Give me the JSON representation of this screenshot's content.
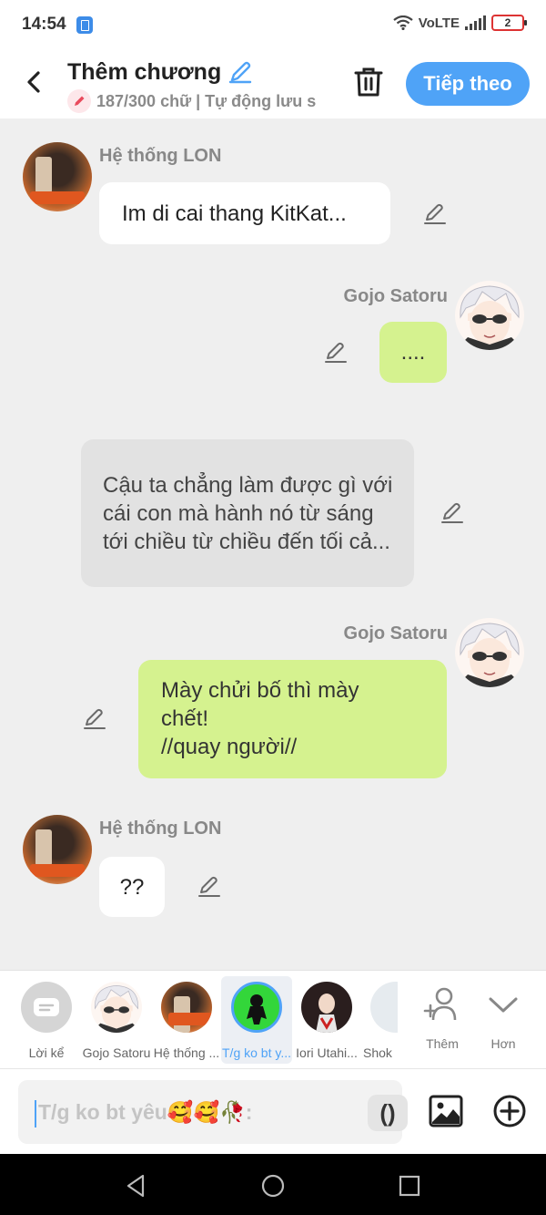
{
  "status_bar": {
    "time": "14:54",
    "network": "VoLTE",
    "battery": "2"
  },
  "header": {
    "title": "Thêm chương",
    "subtitle": "187/300 chữ | Tự động lưu s",
    "next_label": "Tiếp theo"
  },
  "messages": [
    {
      "sender": "Hệ thống LON",
      "text": "Im di cai thang KitKat..."
    },
    {
      "sender": "Gojo Satoru",
      "text": "...."
    },
    {
      "text": "Cậu ta chẳng làm được gì với cái con mà hành nó từ sáng tới chiều từ chiều đến tối cả..."
    },
    {
      "sender": "Gojo Satoru",
      "lines": [
        "Mày chửi bố thì mày",
        "chết!",
        "//quay người//"
      ]
    },
    {
      "sender": "Hệ thống LON",
      "text": "??"
    }
  ],
  "cast": [
    {
      "label": "Lời kể",
      "icon": "narration-icon"
    },
    {
      "label": "Gojo Satoru"
    },
    {
      "label": "Hệ thống ..."
    },
    {
      "label": "T/g ko bt y...",
      "selected": true
    },
    {
      "label": "Iori Utahi..."
    },
    {
      "label": "Shok"
    }
  ],
  "tools": {
    "more_label": "Thêm",
    "less_label": "Hơn"
  },
  "input": {
    "text": "T/g ko bt yêu🥰🥰🥀:",
    "paren_label": "()"
  },
  "colors": {
    "accent": "#4fa3f7",
    "green_bubble": "#d5f28f",
    "background": "#efefef"
  }
}
